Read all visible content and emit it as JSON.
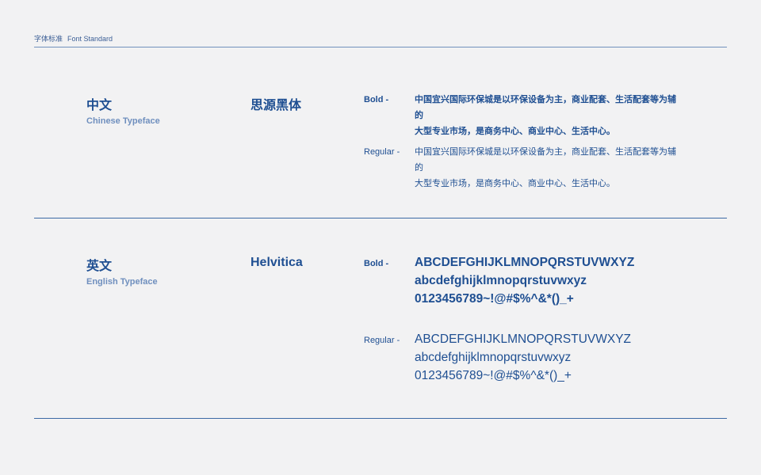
{
  "header": {
    "cn": "字体标准",
    "en": "Font Standard"
  },
  "chinese": {
    "title": "中文",
    "subtitle": "Chinese Typeface",
    "font_name": "思源黑体",
    "bold_label": "Bold -",
    "regular_label": "Regular -",
    "sample_line1": "中国宜兴国际环保城是以环保设备为主，商业配套、生活配套等为辅的",
    "sample_line2": "大型专业市场，是商务中心、商业中心、生活中心。"
  },
  "english": {
    "title": "英文",
    "subtitle": "English Typeface",
    "font_name": "Helvitica",
    "bold_label": "Bold -",
    "regular_label": "Regular -",
    "upper": "ABCDEFGHIJKLMNOPQRSTUVWXYZ",
    "lower": "abcdefghijklmnopqrstuvwxyz",
    "digits": "0123456789~!@#$%^&*()_+"
  },
  "colors": {
    "background": "#f2f2f3",
    "primary": "#1f4f92",
    "secondary": "#6f8fbe",
    "rule": "#3c6aa5"
  }
}
